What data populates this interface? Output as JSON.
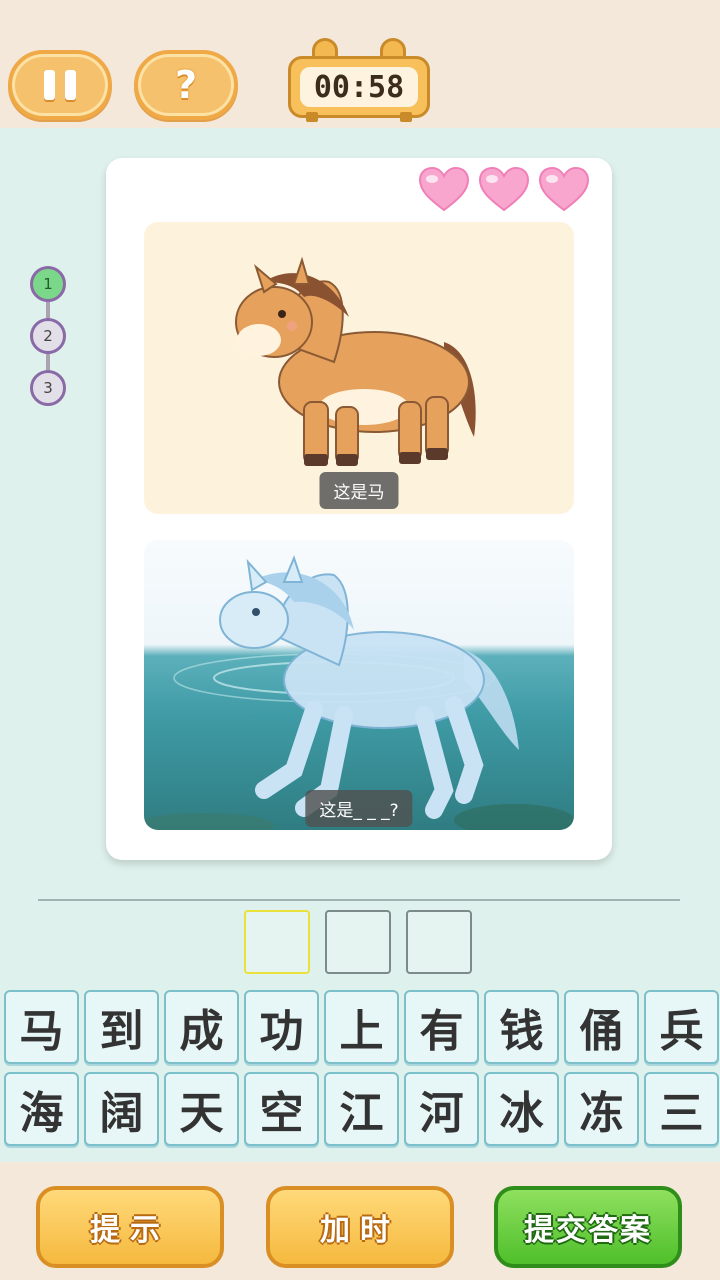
{
  "header": {
    "timer": "00:58"
  },
  "hints_button_symbol": "?",
  "progress": {
    "steps": [
      {
        "label": "1",
        "state": "done"
      },
      {
        "label": "2",
        "state": "todo"
      },
      {
        "label": "3",
        "state": "todo"
      }
    ]
  },
  "lives": {
    "count": 3,
    "max": 3,
    "color": "#f7a8d0"
  },
  "question": {
    "image1_caption": "这是马",
    "image2_caption": "这是_ _ _?"
  },
  "answer": {
    "slots": [
      "",
      "",
      ""
    ],
    "active_index": 0
  },
  "letters": {
    "row1": [
      "马",
      "到",
      "成",
      "功",
      "上",
      "有",
      "钱",
      "俑",
      "兵"
    ],
    "row2": [
      "海",
      "阔",
      "天",
      "空",
      "江",
      "河",
      "冰",
      "冻",
      "三"
    ]
  },
  "actions": {
    "hint_label": "提示",
    "add_time_label": "加时",
    "submit_label": "提交答案"
  },
  "colors": {
    "background": "#dff1ec",
    "top_bar": "#f4e8db",
    "button_yellow": "#f5b93e",
    "button_green": "#4fbf2b"
  }
}
